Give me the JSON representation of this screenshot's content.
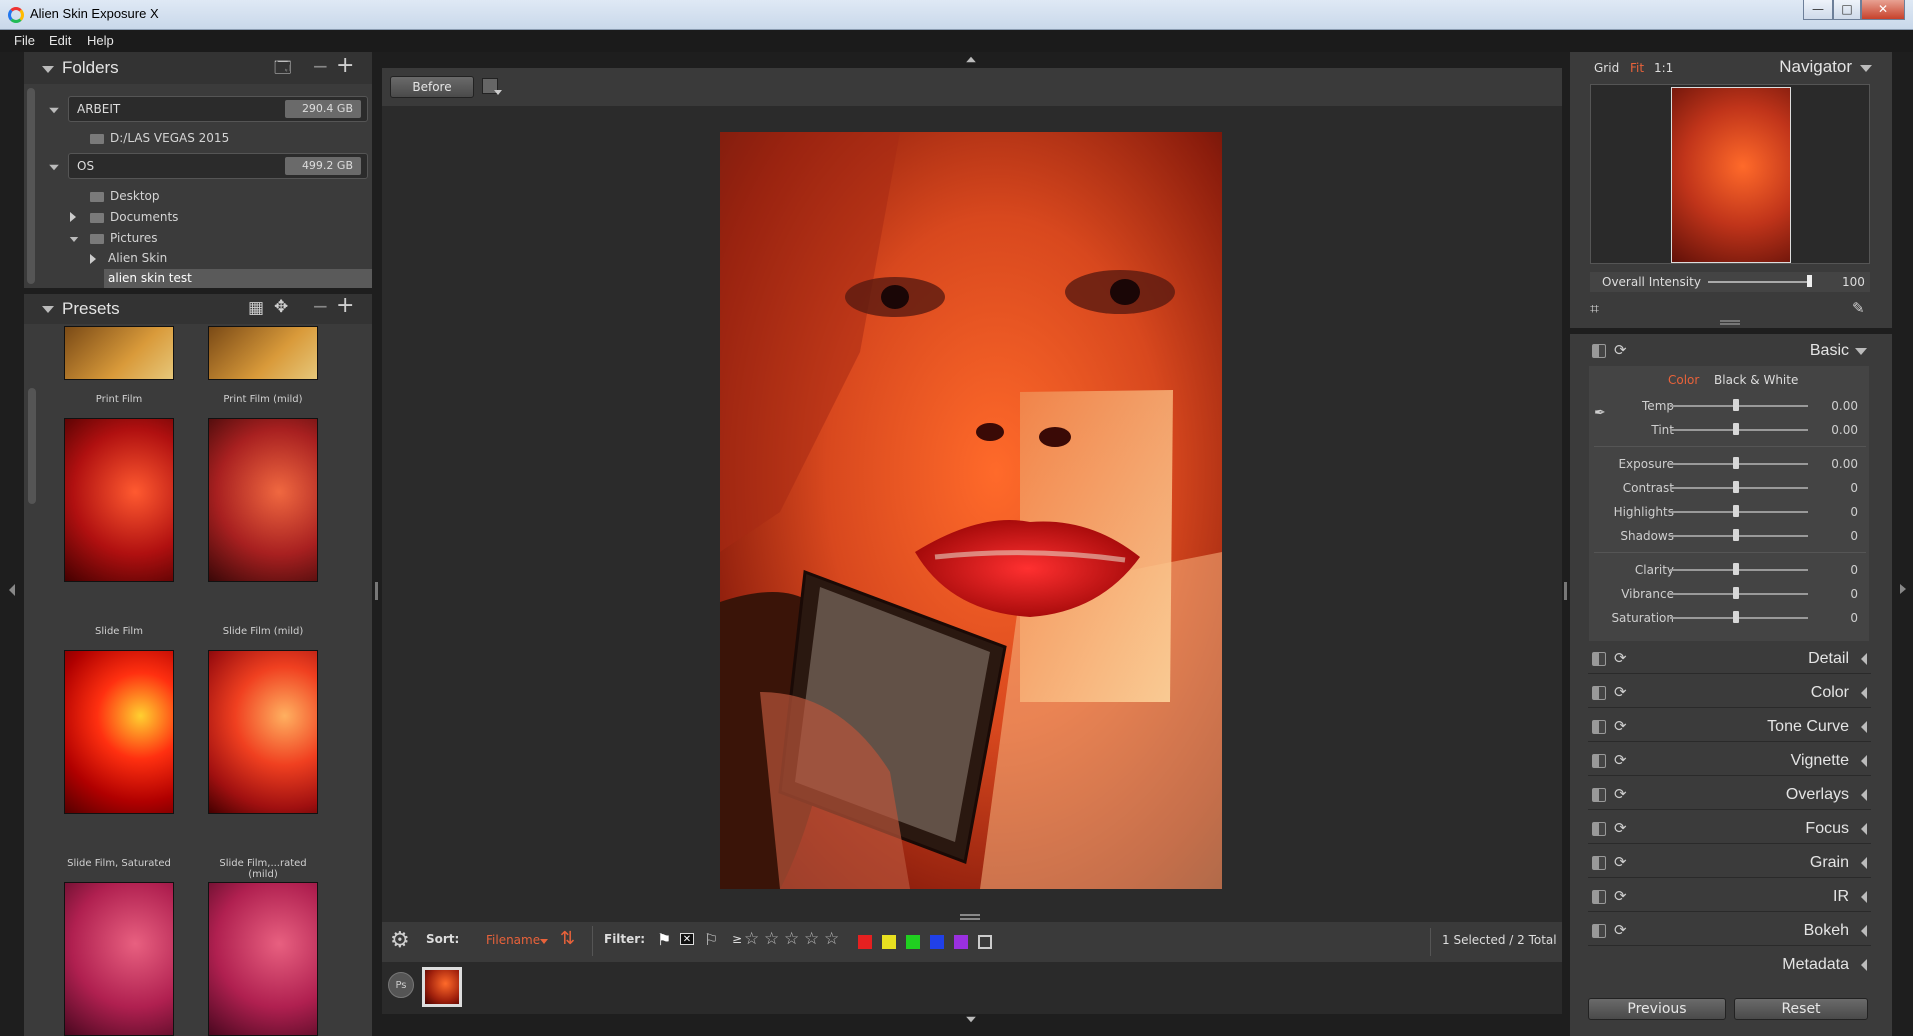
{
  "window": {
    "title": "Alien Skin Exposure X",
    "min": "—",
    "max": "□",
    "close": "✕"
  },
  "menu": [
    "File",
    "Edit",
    "Help"
  ],
  "folders": {
    "title": "Folders",
    "volumes": [
      {
        "name": "ARBEIT",
        "size": "290.4 GB"
      },
      {
        "name": "OS",
        "size": "499.2 GB"
      }
    ],
    "arbeit_children": [
      "D:/LAS VEGAS 2015"
    ],
    "os_children": [
      "Desktop",
      "Documents",
      "Pictures"
    ],
    "pictures_children": [
      "Alien Skin"
    ],
    "selected": "alien skin test"
  },
  "presets": {
    "title": "Presets",
    "items": [
      "Print Film",
      "Print Film (mild)",
      "Slide Film",
      "Slide Film (mild)",
      "Slide Film, Saturated",
      "Slide Film,...rated (mild)"
    ]
  },
  "toolbar": {
    "before_label": "Before"
  },
  "bottombar": {
    "sort_label": "Sort:",
    "sort_value": "Filename",
    "filter_label": "Filter:",
    "gte": "≥",
    "status": "1 Selected / 2 Total",
    "swatch_colors": [
      "#e52020",
      "#e8e020",
      "#20d020",
      "#2040e8",
      "#9a30e0"
    ]
  },
  "filmstrip": {
    "ps_label": "Ps"
  },
  "navigator": {
    "modes": [
      "Grid",
      "Fit",
      "1:1"
    ],
    "active_mode": "Fit",
    "title": "Navigator",
    "intensity_label": "Overall Intensity",
    "intensity_value": "100"
  },
  "basic": {
    "title": "Basic",
    "color_tab": "Color",
    "bw_tab": "Black & White",
    "sliders": [
      {
        "name": "Temp",
        "value": "0.00"
      },
      {
        "name": "Tint",
        "value": "0.00"
      },
      {
        "name": "Exposure",
        "value": "0.00"
      },
      {
        "name": "Contrast",
        "value": "0"
      },
      {
        "name": "Highlights",
        "value": "0"
      },
      {
        "name": "Shadows",
        "value": "0"
      },
      {
        "name": "Clarity",
        "value": "0"
      },
      {
        "name": "Vibrance",
        "value": "0"
      },
      {
        "name": "Saturation",
        "value": "0"
      }
    ]
  },
  "sections": [
    "Detail",
    "Color",
    "Tone Curve",
    "Vignette",
    "Overlays",
    "Focus",
    "Grain",
    "IR",
    "Bokeh"
  ],
  "metadata_label": "Metadata",
  "footer": {
    "previous": "Previous",
    "reset": "Reset"
  },
  "colors": {
    "accent": "#e8623a",
    "panel": "#3b3b3b",
    "background": "#1e1e1e"
  }
}
